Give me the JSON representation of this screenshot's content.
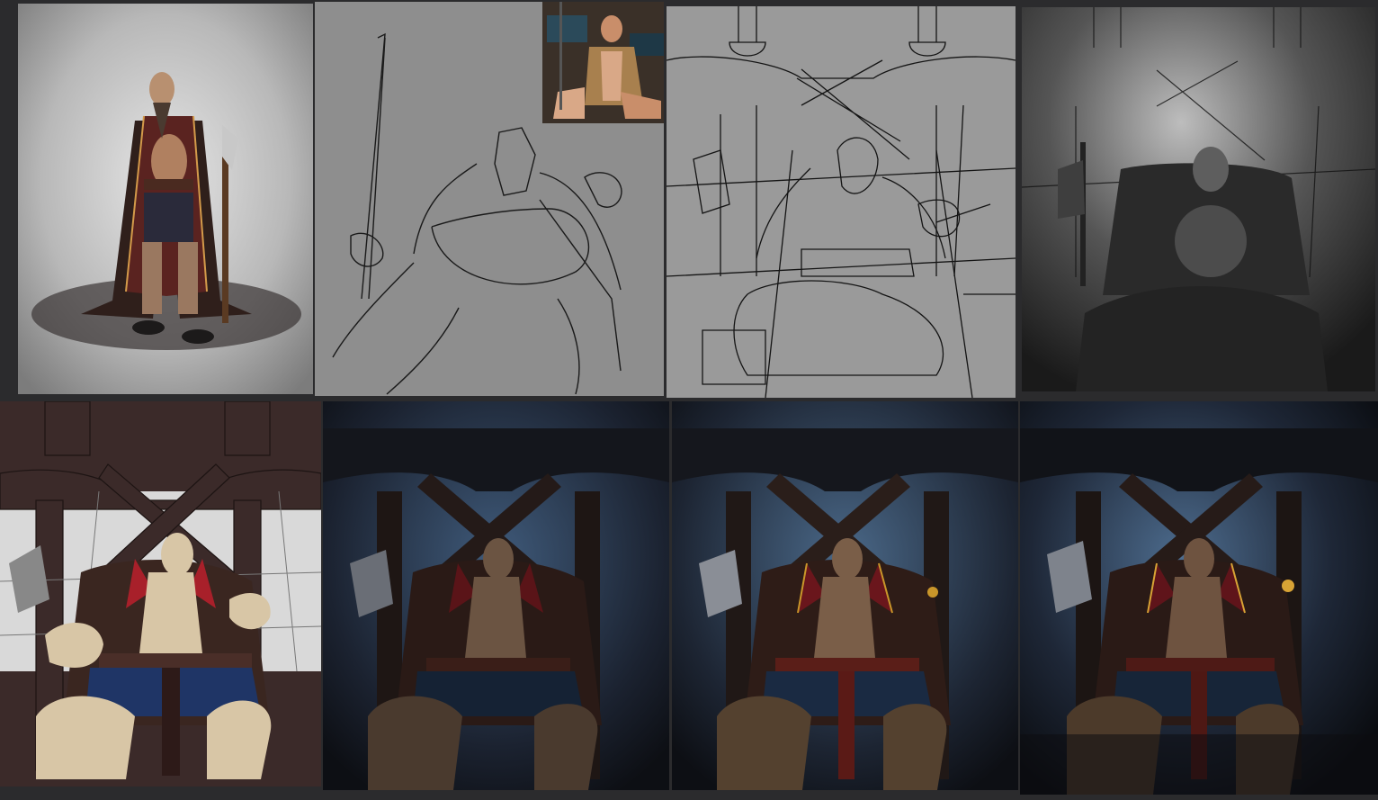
{
  "colors": {
    "background": "#2b2b2d",
    "sketch_gray": "#8e8e8e",
    "lineart_gray": "#9a9a9a",
    "flat_brown": "#3b2a29",
    "flat_skin": "#d8c6a6",
    "flat_cape_red": "#a8202a",
    "flat_pants_blue": "#1f3566",
    "night_blue": "#3f5a7a",
    "gold": "#c9962a"
  },
  "panels": [
    {
      "id": "concept",
      "icon": "warrior-standing-concept-image"
    },
    {
      "id": "rough-sketch",
      "icon": "rough-sketch-image"
    },
    {
      "id": "line-art",
      "icon": "line-art-image"
    },
    {
      "id": "grayscale",
      "icon": "grayscale-value-image"
    },
    {
      "id": "flat-colors",
      "icon": "flat-color-image"
    },
    {
      "id": "color-render-1",
      "icon": "render-stage-1-image"
    },
    {
      "id": "color-render-2",
      "icon": "render-stage-2-image"
    },
    {
      "id": "final-render",
      "icon": "final-render-image"
    }
  ]
}
